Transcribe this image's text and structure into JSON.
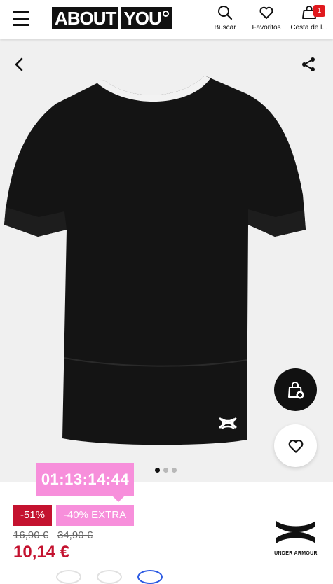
{
  "header": {
    "logo_left": "ABOUT",
    "logo_right": "YOU",
    "search_label": "Buscar",
    "favorites_label": "Favoritos",
    "cart_label": "Cesta de l...",
    "cart_count": "1"
  },
  "gallery": {
    "dots_total": 3,
    "active_dot": 1
  },
  "promo": {
    "timer": "01:13:14:44",
    "discount_badge": "-51%",
    "extra_badge": "-40% EXTRA"
  },
  "price": {
    "old_price_1": "16,90 €",
    "old_price_2": "34,90 €",
    "current_price": "10,14 €"
  },
  "brand": {
    "name": "UNDER ARMOUR"
  },
  "colors": {
    "accent_red": "#c4122f",
    "promo_pink": "#f78fdb",
    "badge_red": "#e0191e"
  }
}
